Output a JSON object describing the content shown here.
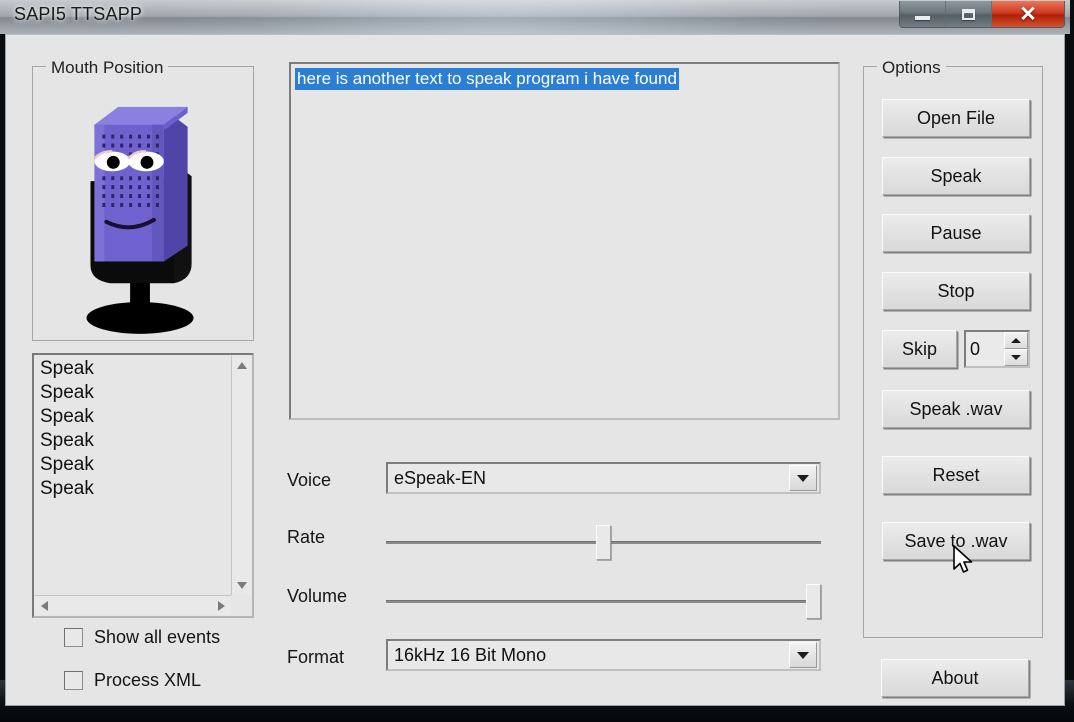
{
  "window": {
    "title": "SAPI5 TTSAPP",
    "buttons": {
      "minimize": "minimize",
      "maximize": "maximize",
      "close": "✕"
    }
  },
  "mouth_position": {
    "group_title": "Mouth Position",
    "figure": "microphone-avatar"
  },
  "events": {
    "items": [
      "Speak",
      "Speak",
      "Speak",
      "Speak",
      "Speak",
      "Speak"
    ]
  },
  "checkboxes": [
    {
      "label": "Show all events",
      "checked": false
    },
    {
      "label": "Process XML",
      "checked": false
    }
  ],
  "text_area": {
    "value": "here is another text to speak program i have found",
    "selected": true,
    "selection_color": "#2a7fd4"
  },
  "fields": {
    "voice": {
      "label": "Voice",
      "value": "eSpeak-EN"
    },
    "rate": {
      "label": "Rate",
      "percent": 50
    },
    "volume": {
      "label": "Volume",
      "percent": 100
    },
    "format": {
      "label": "Format",
      "value": "16kHz 16 Bit Mono"
    }
  },
  "options": {
    "group_title": "Options",
    "open_file": "Open File",
    "speak": "Speak",
    "pause": "Pause",
    "stop": "Stop",
    "skip": "Skip",
    "skip_value": "0",
    "speak_wav": "Speak .wav",
    "reset": "Reset",
    "save_wav": "Save to .wav"
  },
  "about": {
    "label": "About"
  },
  "colors": {
    "dialog_bg": "#e5e5e5",
    "selection": "#2a7fd4",
    "avatar_body": "#6f62cf",
    "close_button": "#cf3a20"
  }
}
